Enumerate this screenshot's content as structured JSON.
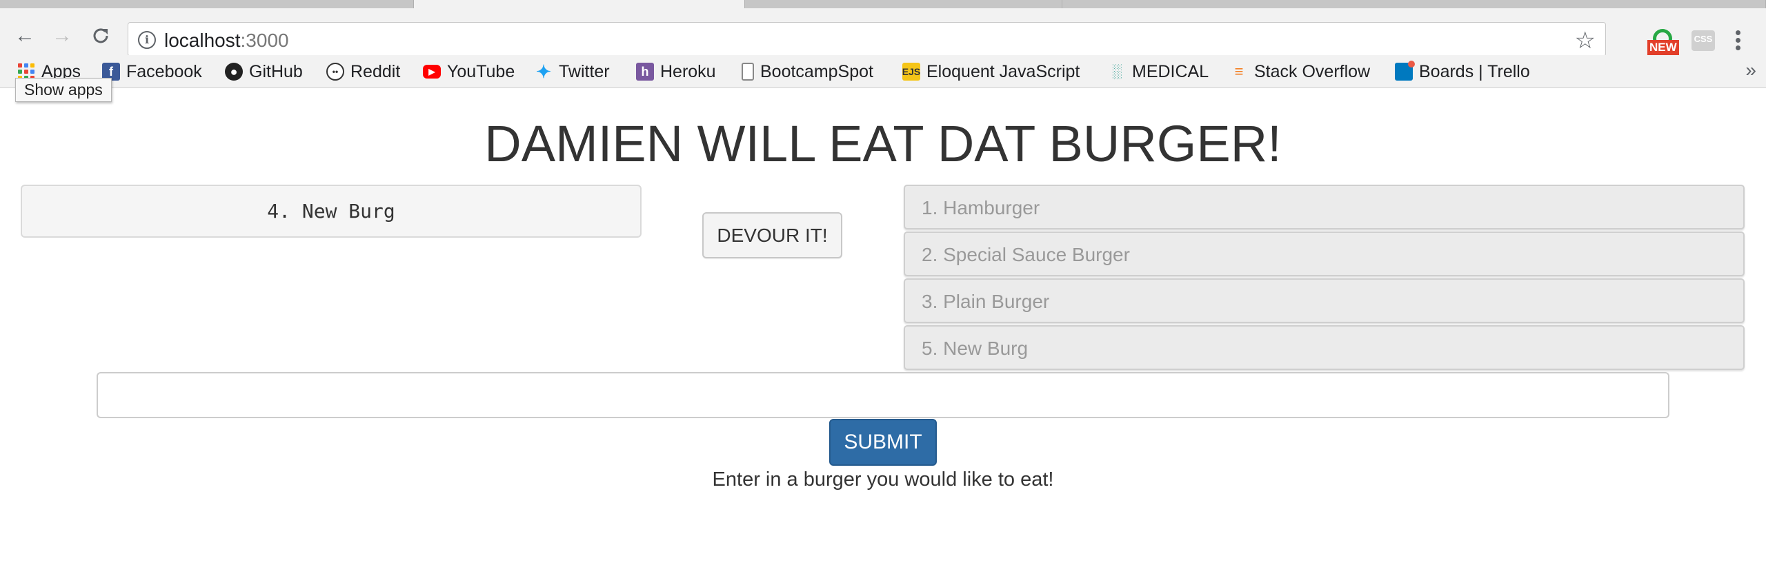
{
  "browser": {
    "url_host": "localhost",
    "url_port": ":3000",
    "extension_new_label": "NEW",
    "extension_css_label": "CSS"
  },
  "bookmarks": {
    "apps": "Apps",
    "apps_tooltip": "Show apps",
    "items": [
      {
        "label": "Facebook",
        "icon": "facebook-icon",
        "color": "#3b5998"
      },
      {
        "label": "GitHub",
        "icon": "github-icon",
        "color": "#222222"
      },
      {
        "label": "Reddit",
        "icon": "reddit-icon",
        "color": "#ff4500"
      },
      {
        "label": "YouTube",
        "icon": "youtube-icon",
        "color": "#ff0000"
      },
      {
        "label": "Twitter",
        "icon": "twitter-icon",
        "color": "#1da1f2"
      },
      {
        "label": "Heroku",
        "icon": "heroku-icon",
        "color": "#79589f"
      },
      {
        "label": "BootcampSpot",
        "icon": "page-icon",
        "color": "#777777"
      },
      {
        "label": "Eloquent JavaScript",
        "icon": "ejs-icon",
        "color": "#f5c518"
      },
      {
        "label": "MEDICAL",
        "icon": "medical-icon",
        "color": "#2a9d8f"
      },
      {
        "label": "Stack Overflow",
        "icon": "stackoverflow-icon",
        "color": "#f48024"
      },
      {
        "label": "Boards | Trello",
        "icon": "trello-icon",
        "color": "#0079bf"
      }
    ],
    "overflow": "»"
  },
  "page": {
    "title": "DAMIEN WILL EAT DAT BURGER!",
    "uneaten_burger": "4. New Burg",
    "devour_label": "DEVOUR IT!",
    "devoured": [
      "1. Hamburger",
      "2. Special Sauce Burger",
      "3. Plain Burger",
      "5. New Burg"
    ],
    "input_value": "",
    "submit_label": "SUBMIT",
    "helper_text": "Enter in a burger you would like to eat!"
  },
  "colors": {
    "submit_bg": "#2e6ca6",
    "title": "#333333"
  }
}
